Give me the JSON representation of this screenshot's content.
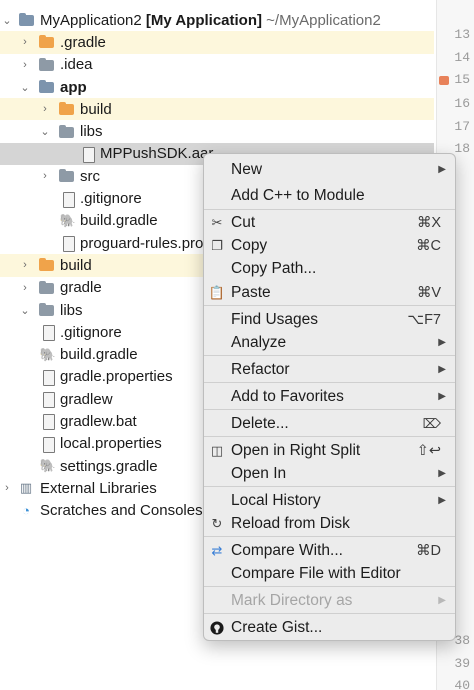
{
  "tree": {
    "root_name": "MyApplication2",
    "root_module": "[My Application]",
    "root_path": "~/MyApplication2",
    "items": [
      {
        "label": ".gradle"
      },
      {
        "label": ".idea"
      },
      {
        "label": "app"
      },
      {
        "label": "build"
      },
      {
        "label": "libs"
      },
      {
        "label": "MPPushSDK.aar"
      },
      {
        "label": "src"
      },
      {
        "label": ".gitignore"
      },
      {
        "label": "build.gradle"
      },
      {
        "label": "proguard-rules.pro"
      },
      {
        "label": "build"
      },
      {
        "label": "gradle"
      },
      {
        "label": "libs"
      },
      {
        "label": ".gitignore"
      },
      {
        "label": "build.gradle"
      },
      {
        "label": "gradle.properties"
      },
      {
        "label": "gradlew"
      },
      {
        "label": "gradlew.bat"
      },
      {
        "label": "local.properties"
      },
      {
        "label": "settings.gradle"
      },
      {
        "label": "External Libraries"
      },
      {
        "label": "Scratches and Consoles"
      }
    ]
  },
  "gutter": {
    "line_numbers": [
      "13",
      "14",
      "15",
      "16",
      "17",
      "18",
      "38",
      "39",
      "40"
    ]
  },
  "menu": {
    "items": [
      {
        "label": "New",
        "submenu": true
      },
      {
        "label": "Add C++ to Module"
      },
      {
        "label": "Cut",
        "shortcut": "⌘X",
        "icon": "scissors-icon"
      },
      {
        "label": "Copy",
        "shortcut": "⌘C",
        "icon": "copy-icon"
      },
      {
        "label": "Copy Path..."
      },
      {
        "label": "Paste",
        "shortcut": "⌘V",
        "icon": "clipboard-icon"
      },
      {
        "label": "Find Usages",
        "shortcut": "⌥F7"
      },
      {
        "label": "Analyze",
        "submenu": true
      },
      {
        "label": "Refactor",
        "submenu": true
      },
      {
        "label": "Add to Favorites",
        "submenu": true
      },
      {
        "label": "Delete...",
        "shortcut_icon": "delete-key-icon"
      },
      {
        "label": "Open in Right Split",
        "shortcut": "⇧↩",
        "icon": "split-icon"
      },
      {
        "label": "Open In",
        "submenu": true
      },
      {
        "label": "Local History",
        "submenu": true
      },
      {
        "label": "Reload from Disk",
        "icon": "reload-icon"
      },
      {
        "label": "Compare With...",
        "shortcut": "⌘D",
        "icon": "compare-arrows-icon"
      },
      {
        "label": "Compare File with Editor"
      },
      {
        "label": "Mark Directory as",
        "submenu": true,
        "disabled": true
      },
      {
        "label": "Create Gist...",
        "icon": "github-icon"
      }
    ]
  },
  "colors": {
    "highlight_row": "#fdf7dc",
    "selected_row": "#d5d5d5",
    "folder_orange": "#f0a34a",
    "menu_background": "#ececec"
  }
}
